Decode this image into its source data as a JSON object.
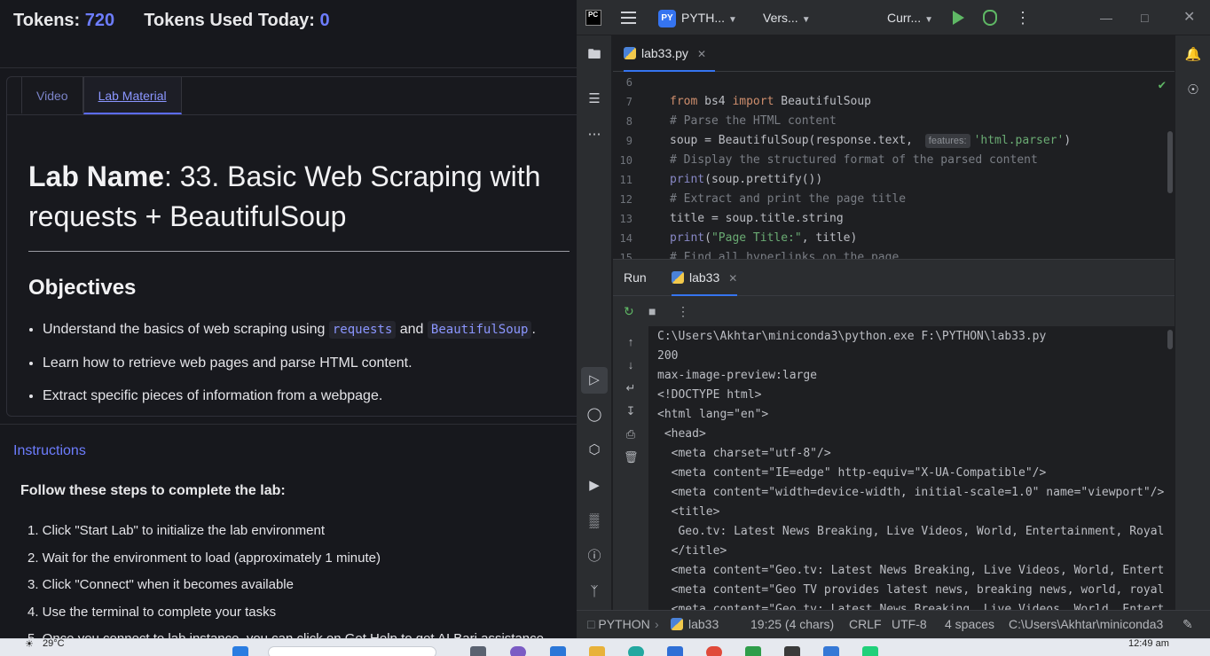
{
  "lab": {
    "tokens_label": "Tokens:",
    "tokens_value": "720",
    "used_label": "Tokens Used Today:",
    "used_value": "0",
    "tabs": [
      {
        "label": "Video"
      },
      {
        "label": "Lab Material"
      }
    ],
    "title_label": "Lab Name",
    "title_text": ": 33. Basic Web Scraping with requests + BeautifulSoup",
    "objectives_heading": "Objectives",
    "objectives": {
      "o1_prefix": "Understand the basics of web scraping using",
      "o1_code1": "requests",
      "o1_and": "and",
      "o1_code2": "BeautifulSoup",
      "o1_suffix": ".",
      "o2": "Learn how to retrieve web pages and parse HTML content.",
      "o3": "Extract specific pieces of information from a webpage."
    },
    "instructions_heading": "Instructions",
    "follow_text": "Follow these steps to complete the lab:",
    "steps": [
      "1. Click \"Start Lab\" to initialize the lab environment",
      "2. Wait for the environment to load (approximately 1 minute)",
      "3. Click \"Connect\" when it becomes available",
      "4. Use the terminal to complete your tasks",
      "5. Once you connect to lab instance, you can click on Get Help to get AI Bari assistance"
    ]
  },
  "ide": {
    "logo": "PC",
    "project_badge": "PY",
    "project_name": "PYTH...",
    "vcs": "Vers...",
    "run_config": "Curr...",
    "file_tab": "lab33.py",
    "line_numbers": [
      "6",
      "7",
      "8",
      "9",
      "10",
      "11",
      "12",
      "13",
      "14",
      "15"
    ],
    "code": {
      "l7_kw1": "from",
      "l7_mid": " bs4 ",
      "l7_kw2": "import",
      "l7_rest": " BeautifulSoup",
      "l8": "# Parse the HTML content",
      "l9_a": "soup = BeautifulSoup(response.text, ",
      "l9_hint": "features:",
      "l9_str": "'html.parser'",
      "l9_end": ")",
      "l10": "# Display the structured format of the parsed content",
      "l11_fn": "print",
      "l11_rest": "(soup.prettify())",
      "l12": "# Extract and print the page title",
      "l13": "title = soup.title.string",
      "l14_fn": "print",
      "l14_a": "(",
      "l14_str": "\"Page Title:\"",
      "l14_b": ", title)",
      "l15": "# Find all hyperlinks on the page"
    },
    "run_label": "Run",
    "run_tab": "lab33",
    "console": [
      "C:\\Users\\Akhtar\\miniconda3\\python.exe F:\\PYTHON\\lab33.py",
      "200",
      "max-image-preview:large",
      "<!DOCTYPE html>",
      "<html lang=\"en\">",
      " <head>",
      "  <meta charset=\"utf-8\"/>",
      "  <meta content=\"IE=edge\" http-equiv=\"X-UA-Compatible\"/>",
      "  <meta content=\"width=device-width, initial-scale=1.0\" name=\"viewport\"/>",
      "  <title>",
      "   Geo.tv: Latest News Breaking, Live Videos, World, Entertainment, Royal",
      "  </title>",
      "  <meta content=\"Geo.tv: Latest News Breaking, Live Videos, World, Entert",
      "  <meta content=\"Geo TV provides latest news, breaking news, world, royal",
      "  <meta content=\"Geo.tv: Latest News Breaking, Live Videos, World, Entert"
    ],
    "status": {
      "project": "PYTHON",
      "file": "lab33",
      "position": "19:25 (4 chars)",
      "line_sep": "CRLF",
      "encoding": "UTF-8",
      "indent": "4 spaces",
      "interpreter": "C:\\Users\\Akhtar\\miniconda3"
    }
  },
  "taskbar": {
    "weather": "29°C",
    "time": "12:49 am"
  },
  "colors": {
    "accent": "#6d7dff",
    "ide_bg": "#1e1f22",
    "run_green": "#5fb865"
  }
}
